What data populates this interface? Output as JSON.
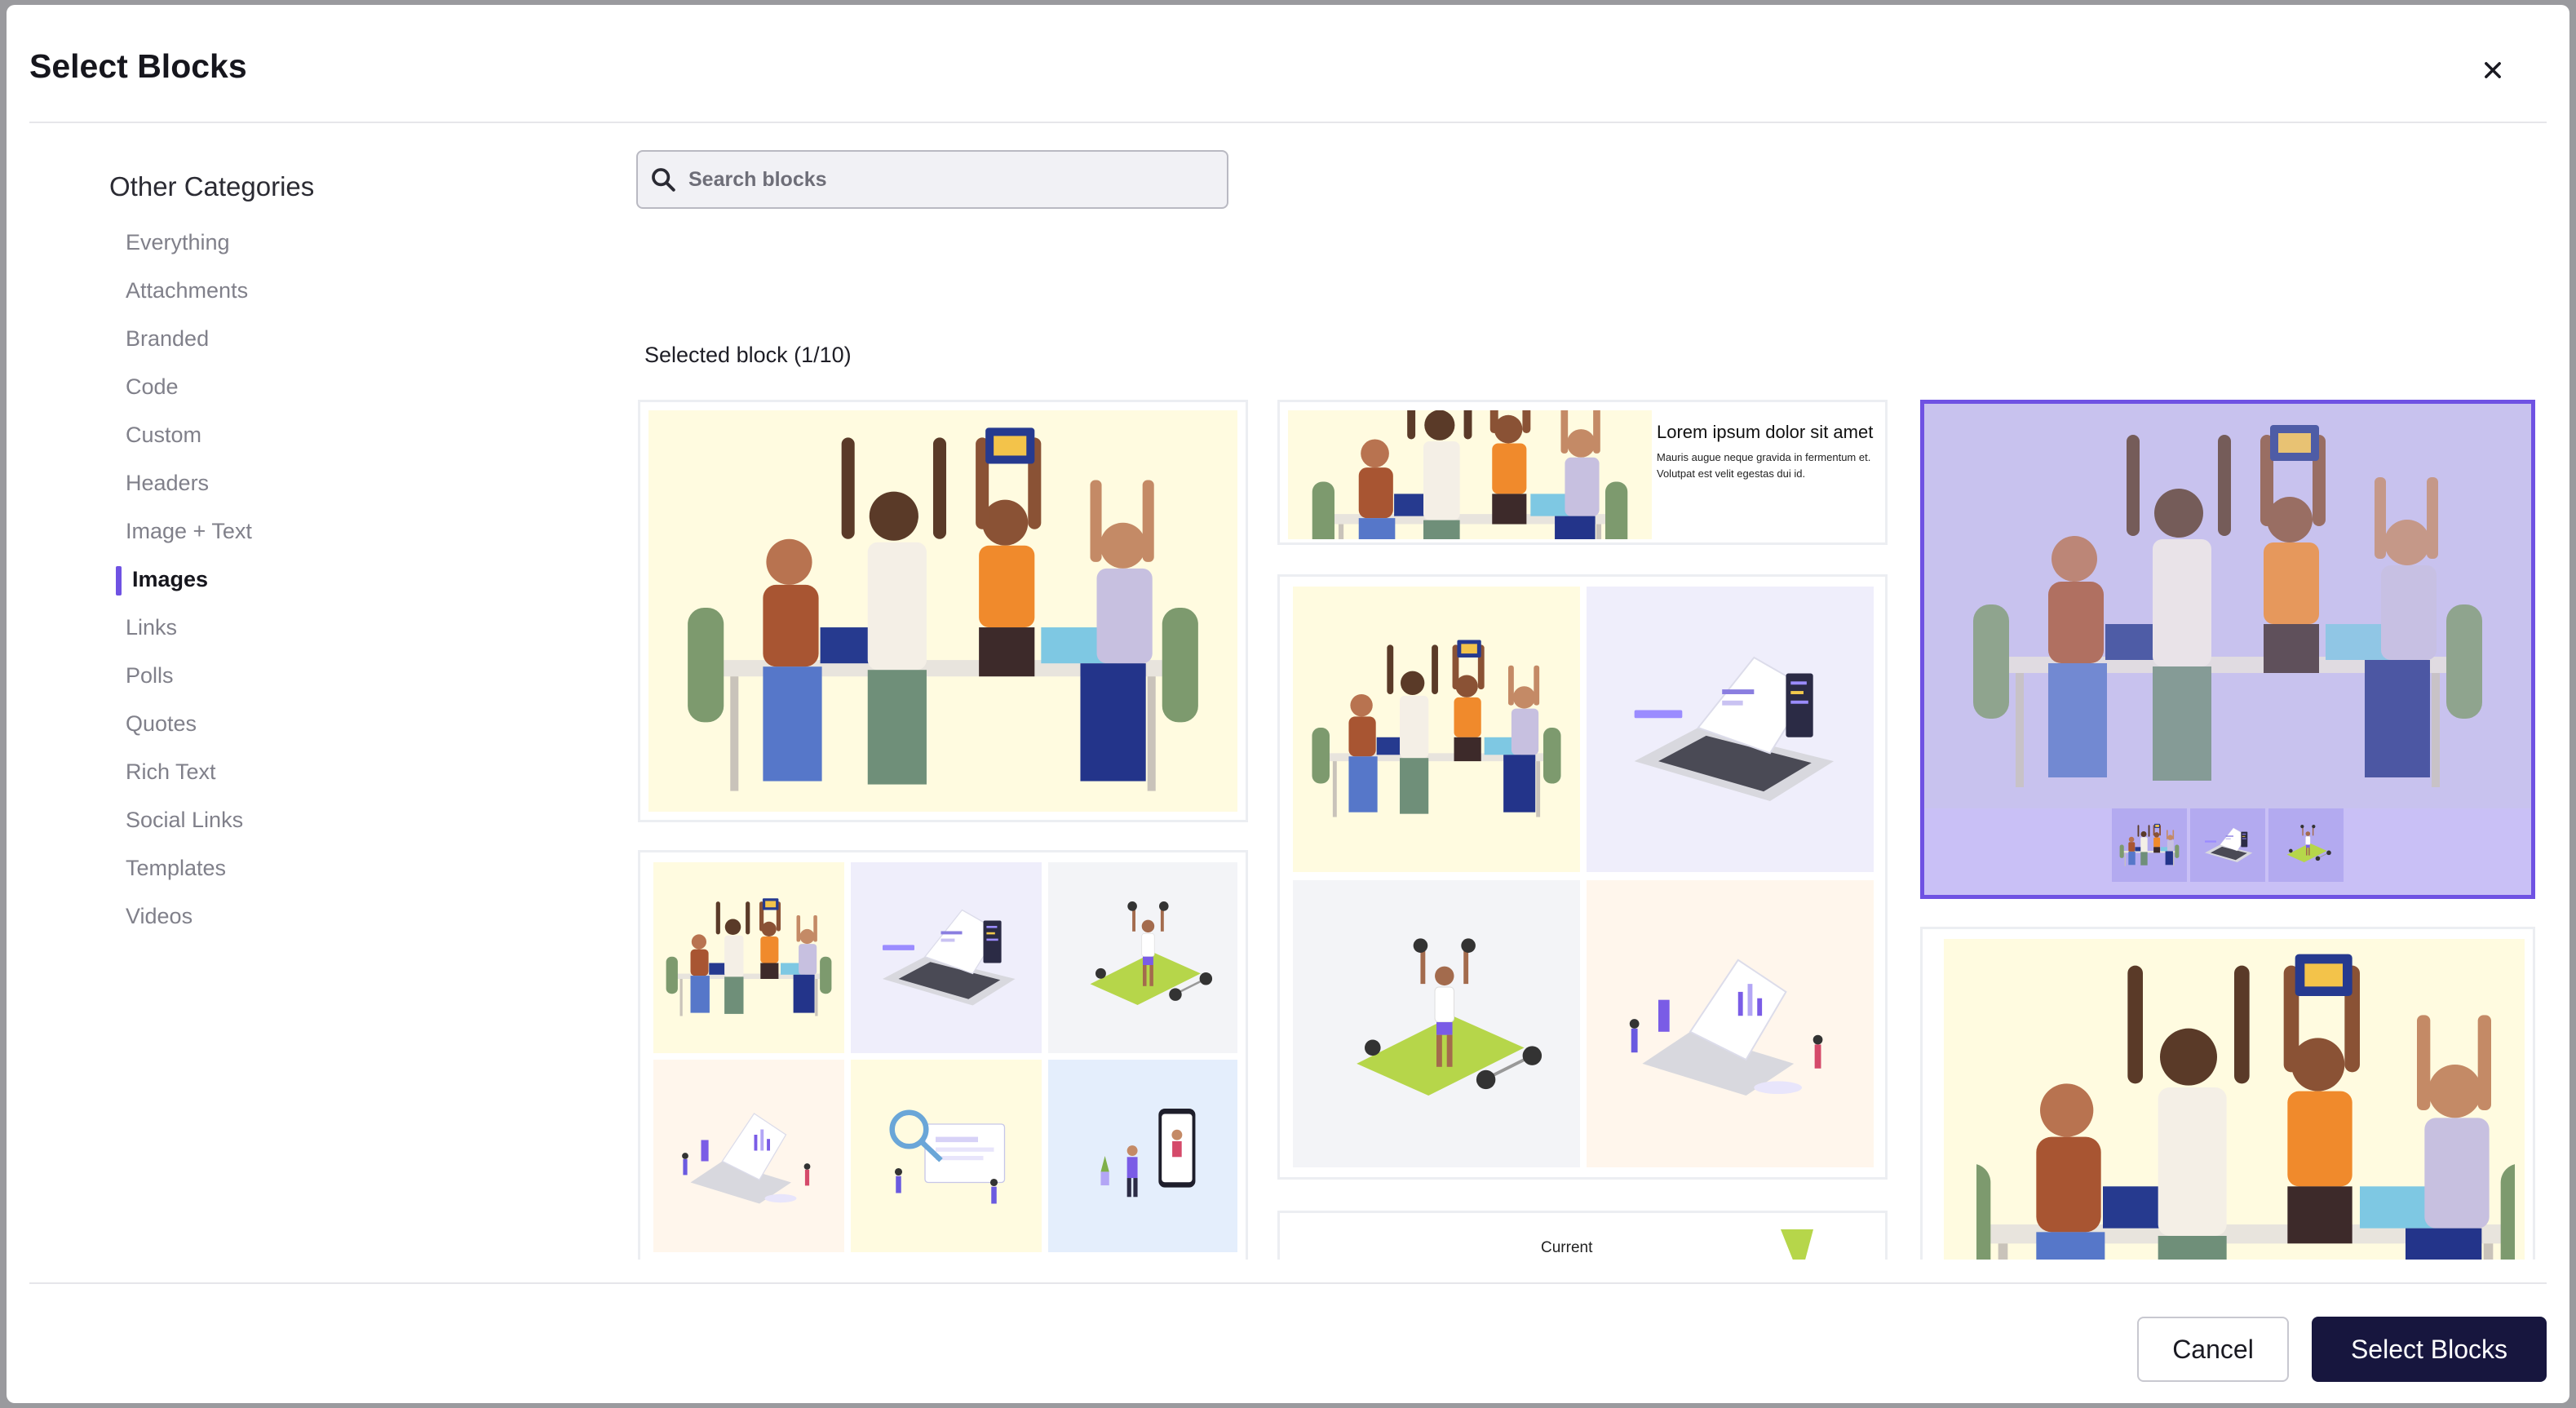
{
  "dialog": {
    "title": "Select Blocks",
    "close_icon": "close-icon"
  },
  "sidebar": {
    "heading": "Other Categories",
    "items": [
      {
        "label": "Everything",
        "active": false
      },
      {
        "label": "Attachments",
        "active": false
      },
      {
        "label": "Branded",
        "active": false
      },
      {
        "label": "Code",
        "active": false
      },
      {
        "label": "Custom",
        "active": false
      },
      {
        "label": "Headers",
        "active": false
      },
      {
        "label": "Image + Text",
        "active": false
      },
      {
        "label": "Images",
        "active": true
      },
      {
        "label": "Links",
        "active": false
      },
      {
        "label": "Polls",
        "active": false
      },
      {
        "label": "Quotes",
        "active": false
      },
      {
        "label": "Rich Text",
        "active": false
      },
      {
        "label": "Social Links",
        "active": false
      },
      {
        "label": "Templates",
        "active": false
      },
      {
        "label": "Videos",
        "active": false
      }
    ]
  },
  "search": {
    "placeholder": "Search blocks",
    "value": "",
    "icon": "search-icon"
  },
  "selection": {
    "label": "Selected block (1/10)"
  },
  "blocks": {
    "image_text": {
      "heading": "Lorem ipsum dolor sit amet",
      "body": "Mauris augue neque gravida in fermentum et. Volutpat est velit egestas dui id."
    },
    "partial_card_text": "Current"
  },
  "footer": {
    "cancel_label": "Cancel",
    "select_label": "Select Blocks"
  },
  "colors": {
    "accent": "#6f52e3",
    "primary_button": "#17163e",
    "illustration_yellow": "#fffbe0",
    "illustration_lavender": "#efeefb",
    "illustration_peach": "#fff6ec",
    "illustration_blue": "#e4eefc",
    "illustration_grey": "#f3f4f7"
  }
}
